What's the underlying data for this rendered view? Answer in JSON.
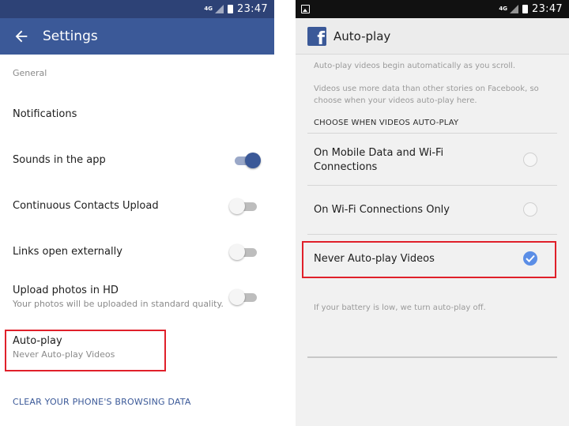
{
  "status_bar": {
    "network": "4G",
    "time": "23:47"
  },
  "left": {
    "appbar": {
      "title": "Settings"
    },
    "section_header": "General",
    "rows": {
      "notifications": {
        "label": "Notifications"
      },
      "sounds": {
        "label": "Sounds in the app",
        "toggle": "on"
      },
      "contacts": {
        "label": "Continuous Contacts Upload",
        "toggle": "off"
      },
      "links": {
        "label": "Links open externally",
        "toggle": "off"
      },
      "upload_hd": {
        "label": "Upload photos in HD",
        "sublabel": "Your photos will be uploaded in standard quality.",
        "toggle": "off"
      },
      "autoplay": {
        "label": "Auto-play",
        "sublabel": "Never Auto-play Videos"
      }
    },
    "clear_link": "CLEAR YOUR PHONE'S BROWSING DATA"
  },
  "right": {
    "appbar": {
      "title": "Auto-play",
      "logo_letter": "f"
    },
    "info_1": "Auto-play videos begin automatically as you scroll.",
    "info_2": "Videos use more data than other stories on Facebook, so choose when your videos auto-play here.",
    "choose_header": "CHOOSE WHEN VIDEOS AUTO-PLAY",
    "options": [
      {
        "label_line1": "On Mobile Data and Wi-Fi",
        "label_line2": "Connections",
        "selected": false
      },
      {
        "label": "On Wi-Fi Connections Only",
        "selected": false
      },
      {
        "label": "Never Auto-play Videos",
        "selected": true
      }
    ],
    "battery_note": "If your battery is low, we turn auto-play off."
  },
  "colors": {
    "facebook_blue": "#3b5998",
    "status_bar_left": "#2d4276",
    "highlight_red": "#e0202a",
    "radio_selected": "#5b8ee6"
  }
}
